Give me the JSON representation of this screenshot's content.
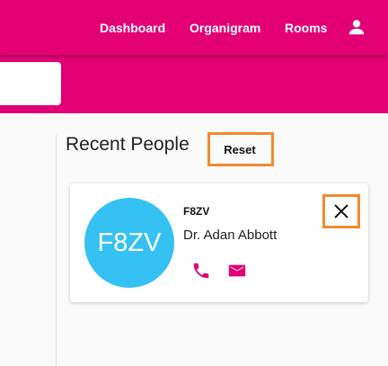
{
  "nav": {
    "dashboard": "Dashboard",
    "organigram": "Organigram",
    "rooms": "Rooms",
    "user_icon": "account-icon"
  },
  "main": {
    "section_title": "Recent People",
    "reset_label": "Reset"
  },
  "person_card": {
    "avatar_text": "F8ZV",
    "code": "F8ZV",
    "name": "Dr. Adan Abbott",
    "phone_icon": "phone-icon",
    "mail_icon": "mail-icon",
    "close_icon": "close-icon"
  },
  "colors": {
    "brand": "#e20074",
    "avatar": "#35c1f1",
    "highlight": "#f28a2e"
  }
}
